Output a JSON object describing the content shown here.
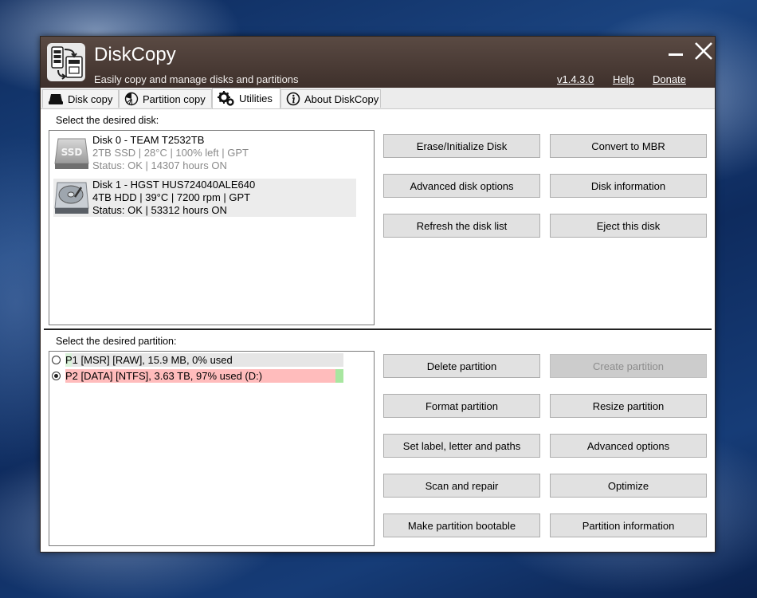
{
  "app": {
    "title": "DiskCopy",
    "subtitle": "Easily copy and manage disks and partitions",
    "version": "v1.4.3.0",
    "help": "Help",
    "donate": "Donate"
  },
  "tabs": [
    {
      "label": "Disk copy",
      "icon": "disk-icon"
    },
    {
      "label": "Partition copy",
      "icon": "partition-pie-icon"
    },
    {
      "label": "Utilities",
      "icon": "gears-icon",
      "active": true
    },
    {
      "label": "About DiskCopy",
      "icon": "info-icon"
    }
  ],
  "disk_section": {
    "label": "Select the desired disk:",
    "disks": [
      {
        "name": "Disk 0 - TEAM T2532TB",
        "details": "2TB SSD | 28°C | 100% left | GPT",
        "status": "Status: OK | 14307 hours ON",
        "icon": "ssd-icon",
        "selected": false
      },
      {
        "name": "Disk 1 - HGST HUS724040ALE640",
        "details": "4TB HDD | 39°C | 7200 rpm | GPT",
        "status": "Status: OK | 53312 hours ON",
        "icon": "hdd-icon",
        "selected": true
      }
    ],
    "buttons": {
      "erase": "Erase/Initialize Disk",
      "convert": "Convert to MBR",
      "advanced": "Advanced disk options",
      "info": "Disk information",
      "refresh": "Refresh the disk list",
      "eject": "Eject this disk"
    }
  },
  "partition_section": {
    "label": "Select the desired partition:",
    "partitions": [
      {
        "label": "P1 [MSR] [RAW], 15.9 MB, 0% used",
        "used_fraction": 0.0,
        "selected": false,
        "fill_color": "#d9f2d9",
        "rest_color": "#e6e6e6"
      },
      {
        "label": "P2 [DATA] [NTFS], 3.63 TB, 97% used (D:)",
        "used_fraction": 0.97,
        "selected": true,
        "fill_color": "#ffbcbc",
        "rest_color": "#a8e6a0"
      }
    ],
    "buttons": {
      "delete": "Delete partition",
      "create": "Create partition",
      "format": "Format partition",
      "resize": "Resize partition",
      "label_paths": "Set label, letter and paths",
      "advanced": "Advanced options",
      "scan": "Scan and repair",
      "optimize": "Optimize",
      "bootable": "Make partition bootable",
      "info": "Partition information"
    }
  },
  "colors": {
    "titlebar": "#4a3b35",
    "button_face": "#e1e1e1",
    "disabled_button": "#cccccc"
  }
}
